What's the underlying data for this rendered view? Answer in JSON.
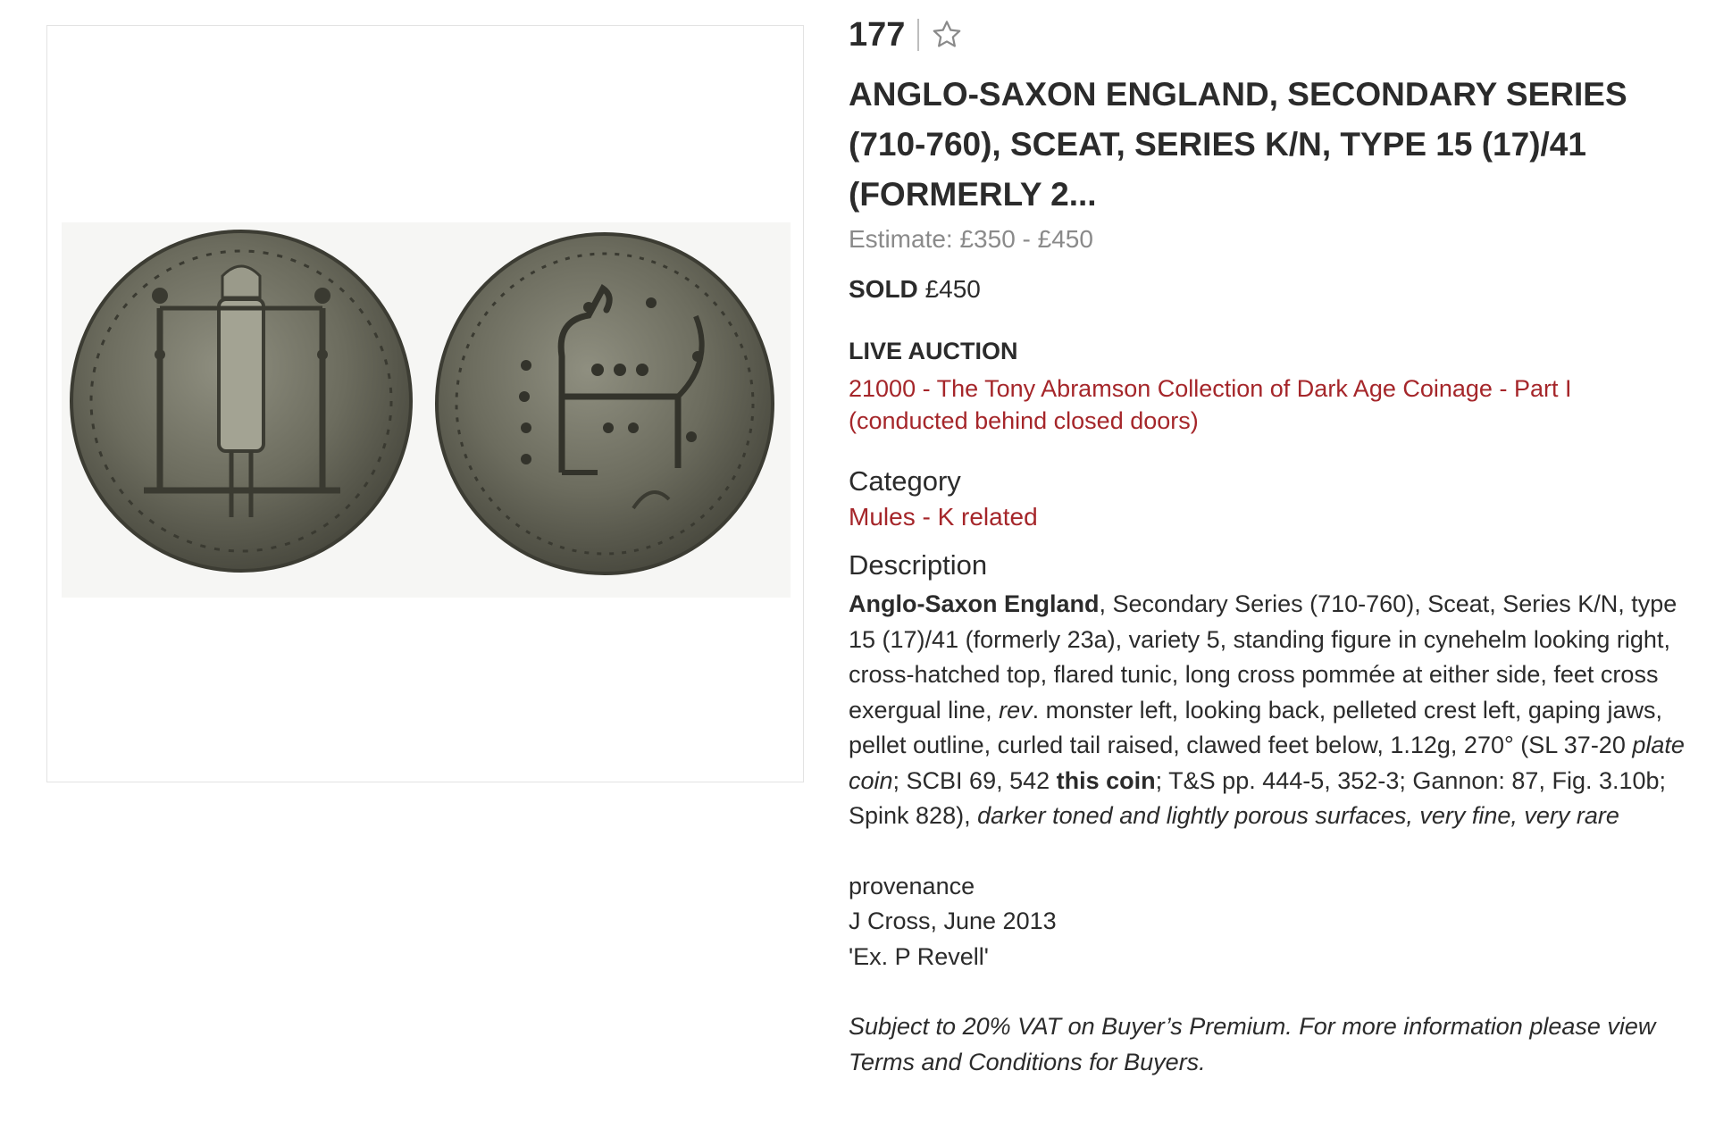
{
  "lot": {
    "number": "177",
    "watch_icon": "star-outline-icon",
    "title": "ANGLO-SAXON ENGLAND, SECONDARY SERIES (710-760), SCEAT, SERIES K/N, TYPE 15 (17)/41 (FORMERLY 2...",
    "estimate": "Estimate: £350 - £450",
    "sold_label": "SOLD",
    "sold_price": "£450"
  },
  "auction": {
    "label": "LIVE AUCTION",
    "link": "21000 - The Tony Abramson Collection of Dark Age Coinage - Part I (conducted behind closed doors)"
  },
  "category": {
    "heading": "Category",
    "link": "Mules - K related"
  },
  "description": {
    "heading": "Description",
    "p1_bold": "Anglo-Saxon England",
    "p1_text1": ", Secondary Series (710-760), Sceat, Series K/N, type 15 (17)/41 (formerly 23a), variety 5, standing figure in cynehelm looking right, cross-hatched top, flared tunic, long cross pommée at either side, feet cross exergual line, ",
    "p1_rev": "rev",
    "p1_text2": ". monster left, looking back, pelleted crest left, gaping jaws, pellet outline, curled tail raised, clawed feet below, 1.12g, 270° (SL 37-20 ",
    "p1_plate": "plate coin",
    "p1_text3": "; SCBI 69, 542 ",
    "p1_thiscoin": "this coin",
    "p1_text4": "; T&S pp. 444-5, 352-3; Gannon: 87, Fig. 3.10b; Spink 828), ",
    "p1_grade": "darker toned and lightly porous surfaces, very fine, very rare",
    "provenance_label": "provenance",
    "provenance_1": "J Cross, June 2013",
    "provenance_2": "'Ex. P Revell'",
    "vat_note": "Subject to 20% VAT on Buyer’s Premium. For more information please view Terms and Conditions for Buyers."
  },
  "colors": {
    "accent_red": "#a5262a",
    "muted_gray": "#8a8a8a",
    "text": "#2b2b2b"
  }
}
